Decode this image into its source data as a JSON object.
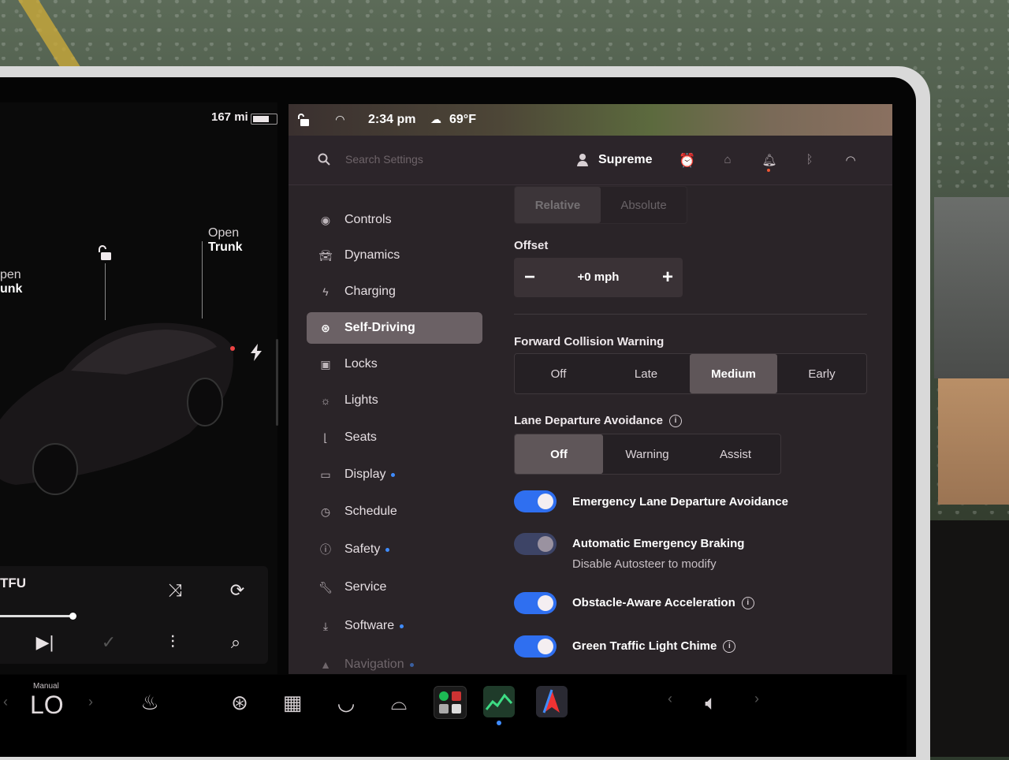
{
  "status": {
    "range": "167 mi",
    "time": "2:34 pm",
    "temperature": "69°F"
  },
  "car": {
    "open_frunk_label_1": "pen",
    "open_frunk_label_2": "unk",
    "open_trunk_label_1": "Open",
    "open_trunk_label_2": "Trunk"
  },
  "media": {
    "title": "TFU"
  },
  "topbar": {
    "search_placeholder": "Search Settings",
    "user_name": "Supreme"
  },
  "sidebar": {
    "items": [
      {
        "label": "Controls",
        "icon": "toggle-icon"
      },
      {
        "label": "Dynamics",
        "icon": "car-icon"
      },
      {
        "label": "Charging",
        "icon": "bolt-icon"
      },
      {
        "label": "Self-Driving",
        "icon": "steering-wheel-icon",
        "active": true
      },
      {
        "label": "Locks",
        "icon": "lock-icon"
      },
      {
        "label": "Lights",
        "icon": "light-icon"
      },
      {
        "label": "Seats",
        "icon": "seat-icon"
      },
      {
        "label": "Display",
        "icon": "display-icon",
        "dot": true
      },
      {
        "label": "Schedule",
        "icon": "alarm-icon"
      },
      {
        "label": "Safety",
        "icon": "alert-icon",
        "dot": true
      },
      {
        "label": "Service",
        "icon": "wrench-icon"
      },
      {
        "label": "Software",
        "icon": "download-icon",
        "dot": true
      },
      {
        "label": "Navigation",
        "icon": "navigation-icon",
        "dot": true
      }
    ]
  },
  "content": {
    "speed_mode_options": [
      "Relative",
      "Absolute"
    ],
    "offset_label": "Offset",
    "offset_value": "+0 mph",
    "fcw_label": "Forward Collision Warning",
    "fcw_options": [
      "Off",
      "Late",
      "Medium",
      "Early"
    ],
    "fcw_selected": "Medium",
    "lda_label": "Lane Departure Avoidance",
    "lda_options": [
      "Off",
      "Warning",
      "Assist"
    ],
    "lda_selected": "Off",
    "toggles": [
      {
        "label": "Emergency Lane Departure Avoidance",
        "on": true
      },
      {
        "label": "Automatic Emergency Braking",
        "sub": "Disable Autosteer to modify",
        "on": true,
        "disabled": true
      },
      {
        "label": "Obstacle-Aware Acceleration",
        "on": true,
        "info": true
      },
      {
        "label": "Green Traffic Light Chime",
        "on": true,
        "info": true
      }
    ]
  },
  "climate": {
    "mode": "Manual",
    "temperature": "LO"
  },
  "colors": {
    "accent": "#2f6ff0",
    "panel": "#2a2428",
    "active_nav": "#6b6165"
  }
}
